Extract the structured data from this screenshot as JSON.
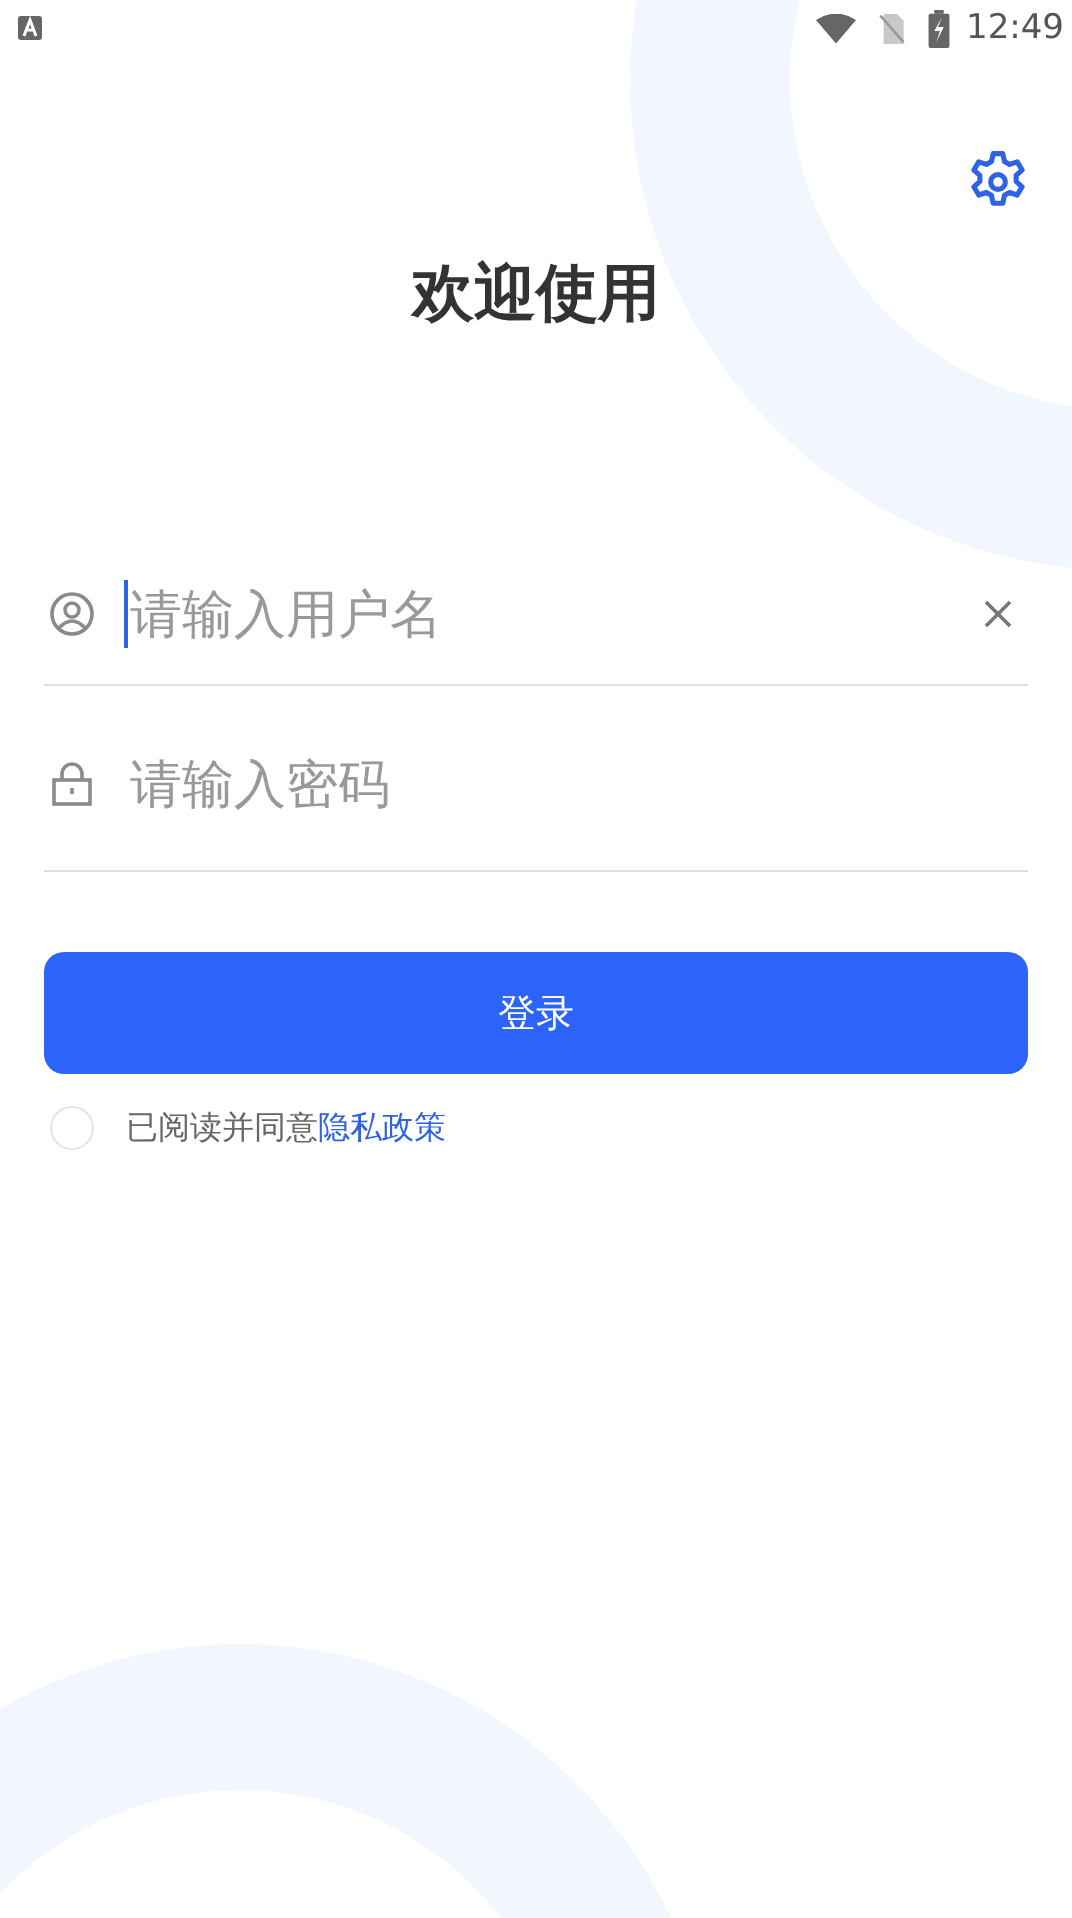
{
  "status_bar": {
    "time": "12:49"
  },
  "title": "欢迎使用",
  "fields": [
    {
      "kind": "username",
      "placeholder": "请输入用户名",
      "focused": true,
      "clearable": true
    },
    {
      "kind": "password",
      "placeholder": "请输入密码",
      "focused": false,
      "clearable": false
    }
  ],
  "login_button": "登录",
  "agreement": {
    "checked": false,
    "text": "已阅读并同意",
    "link": "隐私政策"
  }
}
